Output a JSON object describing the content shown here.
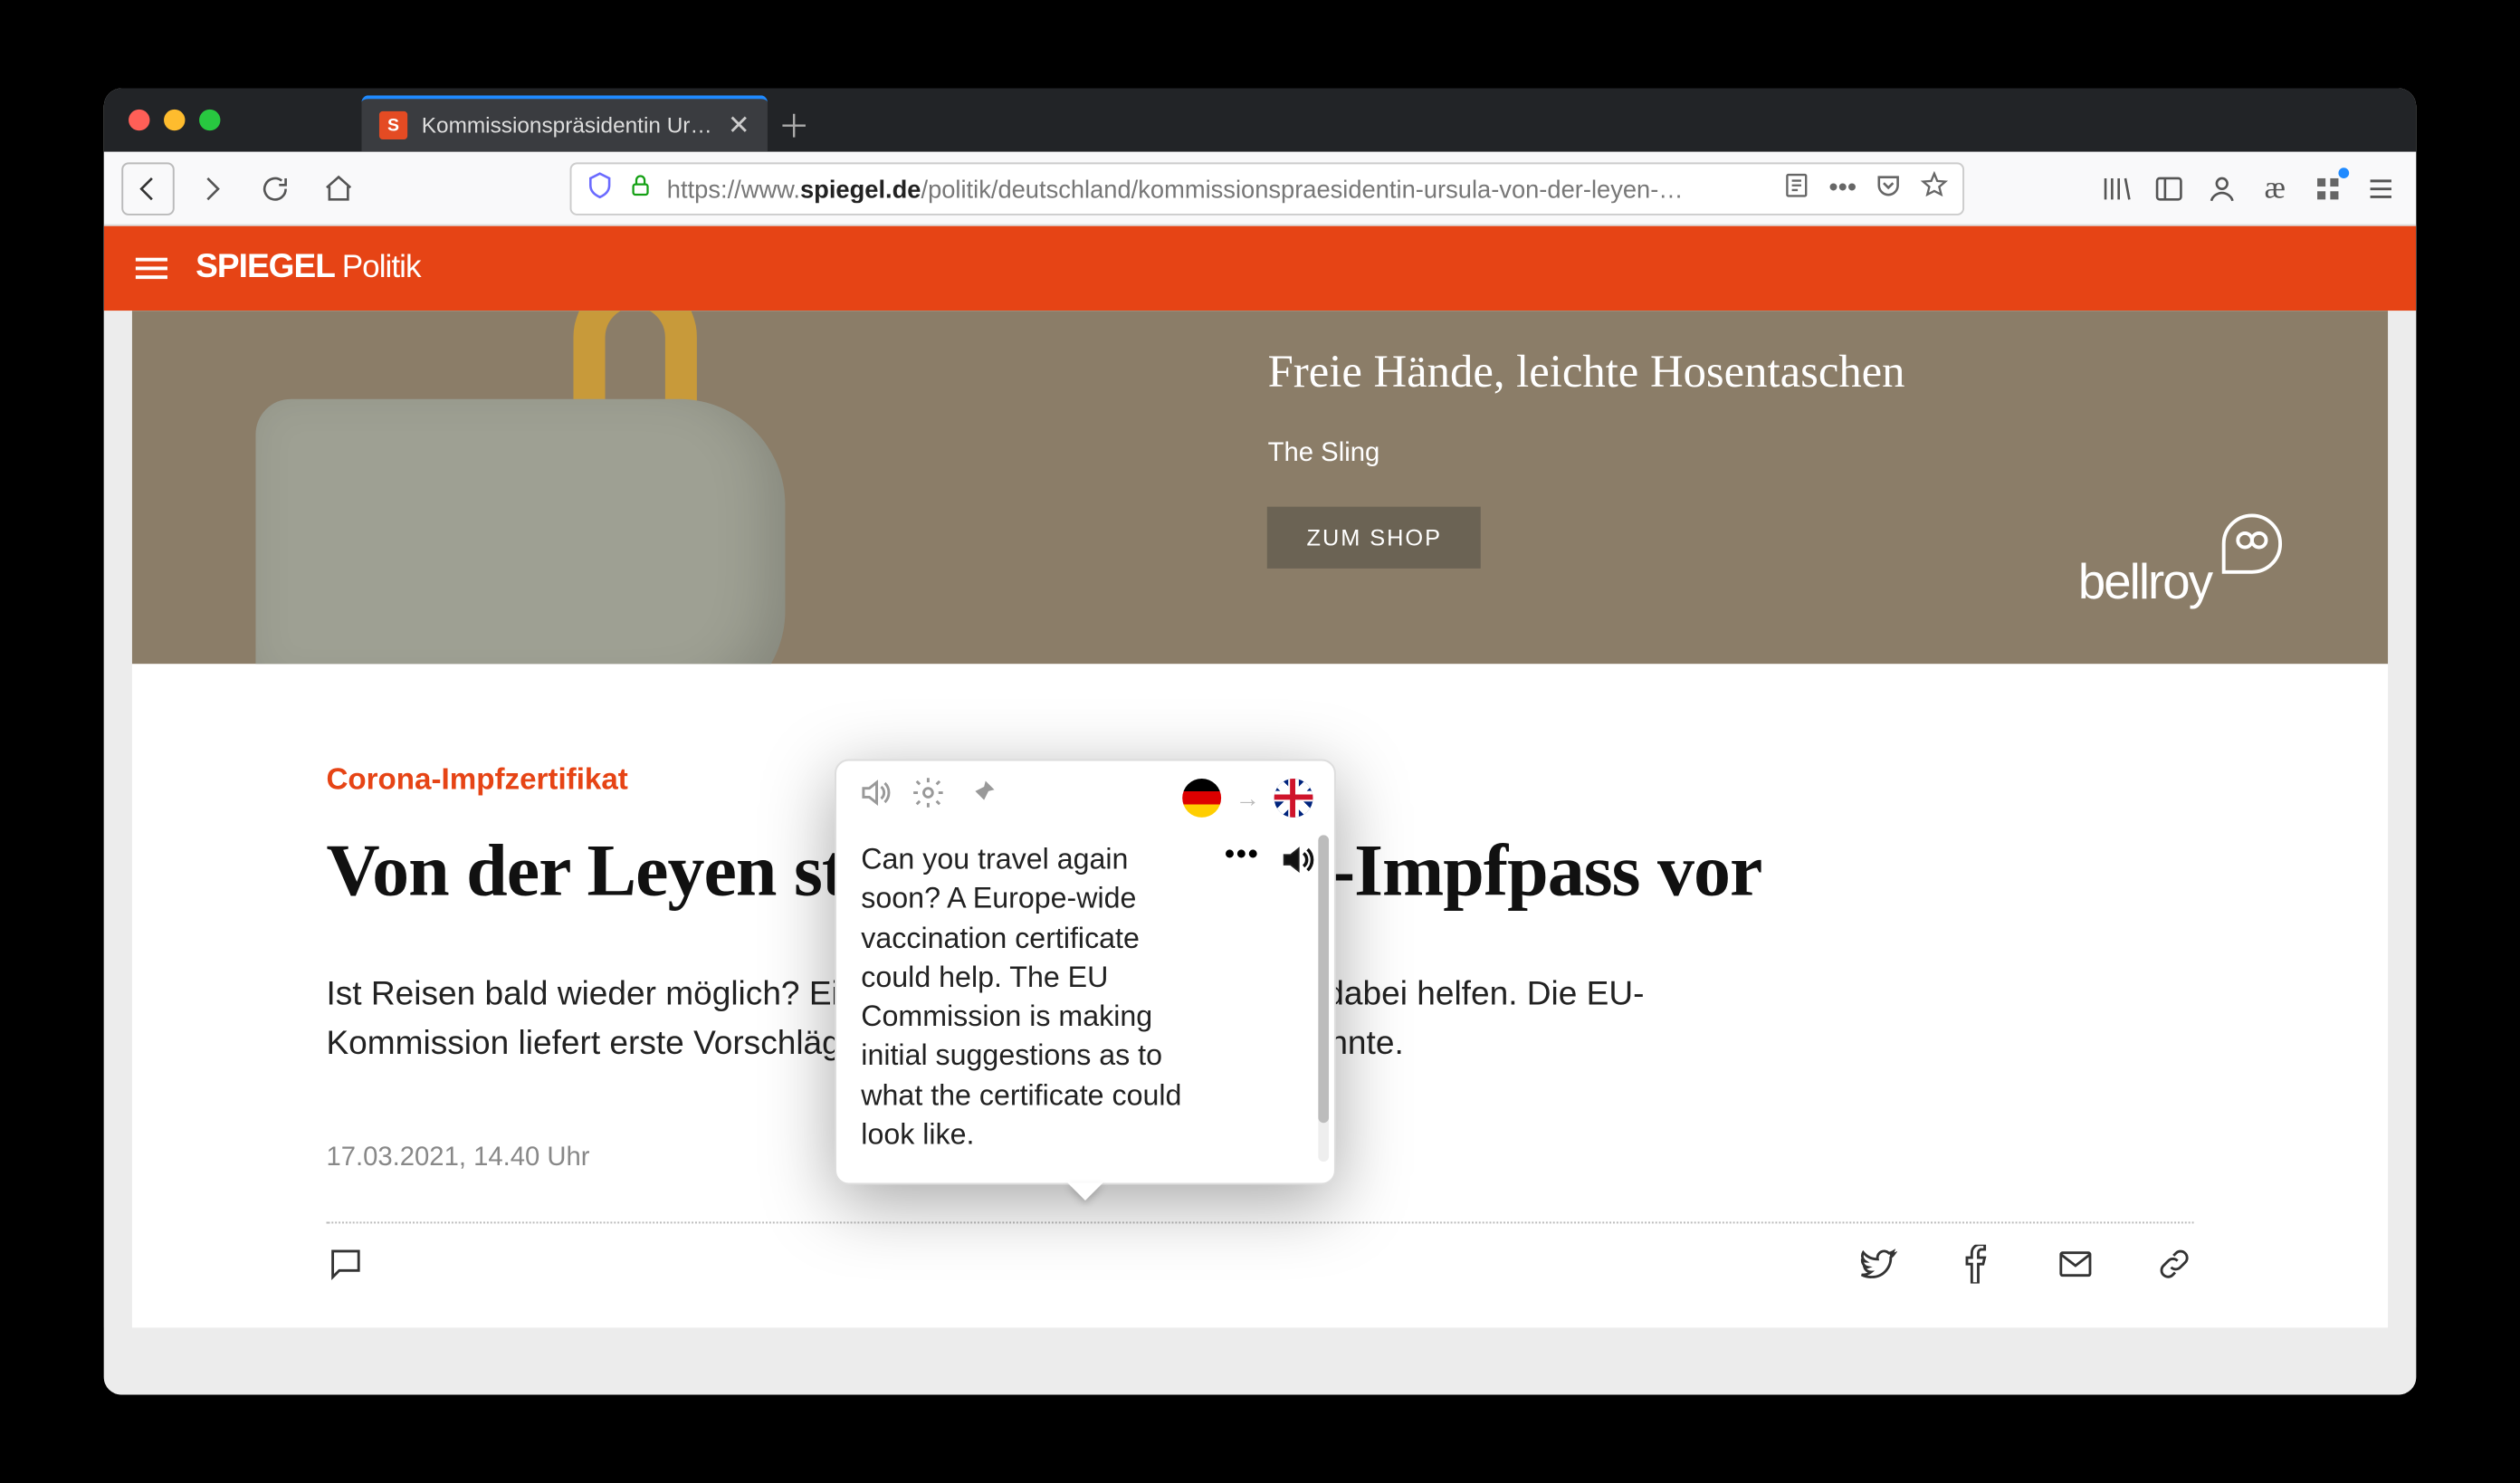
{
  "tab": {
    "title": "Kommissionspräsidentin Ursula…",
    "favicon_letter": "S"
  },
  "url": {
    "prefix": "https://www.",
    "host": "spiegel.de",
    "path": "/politik/deutschland/kommissionspraesidentin-ursula-von-der-leyen-…"
  },
  "site_header": {
    "brand": "SPIEGEL",
    "section": "Politik"
  },
  "ad": {
    "headline": "Freie Hände, leichte Hosentaschen",
    "subline": "The Sling",
    "button": "ZUM SHOP",
    "brand": "bellroy"
  },
  "article": {
    "kicker": "Corona-Impfzertifikat",
    "headline": "Von der Leyen stellt Plan für EU-Impfpass vor",
    "lede": "Ist Reisen bald wieder möglich? Ein europaweiter Impfpass könnte dabei helfen. Die EU-Kommission liefert erste Vorschläge, wie das Zertifikat aussehen könnte.",
    "timestamp": "17.03.2021, 14.40 Uhr"
  },
  "popup": {
    "translation": "Can you travel again soon? A Europe-wide vaccination certificate could help. The EU Commission is making initial suggestions as to what the certificate could look like.",
    "from_lang": "de",
    "to_lang": "en"
  }
}
